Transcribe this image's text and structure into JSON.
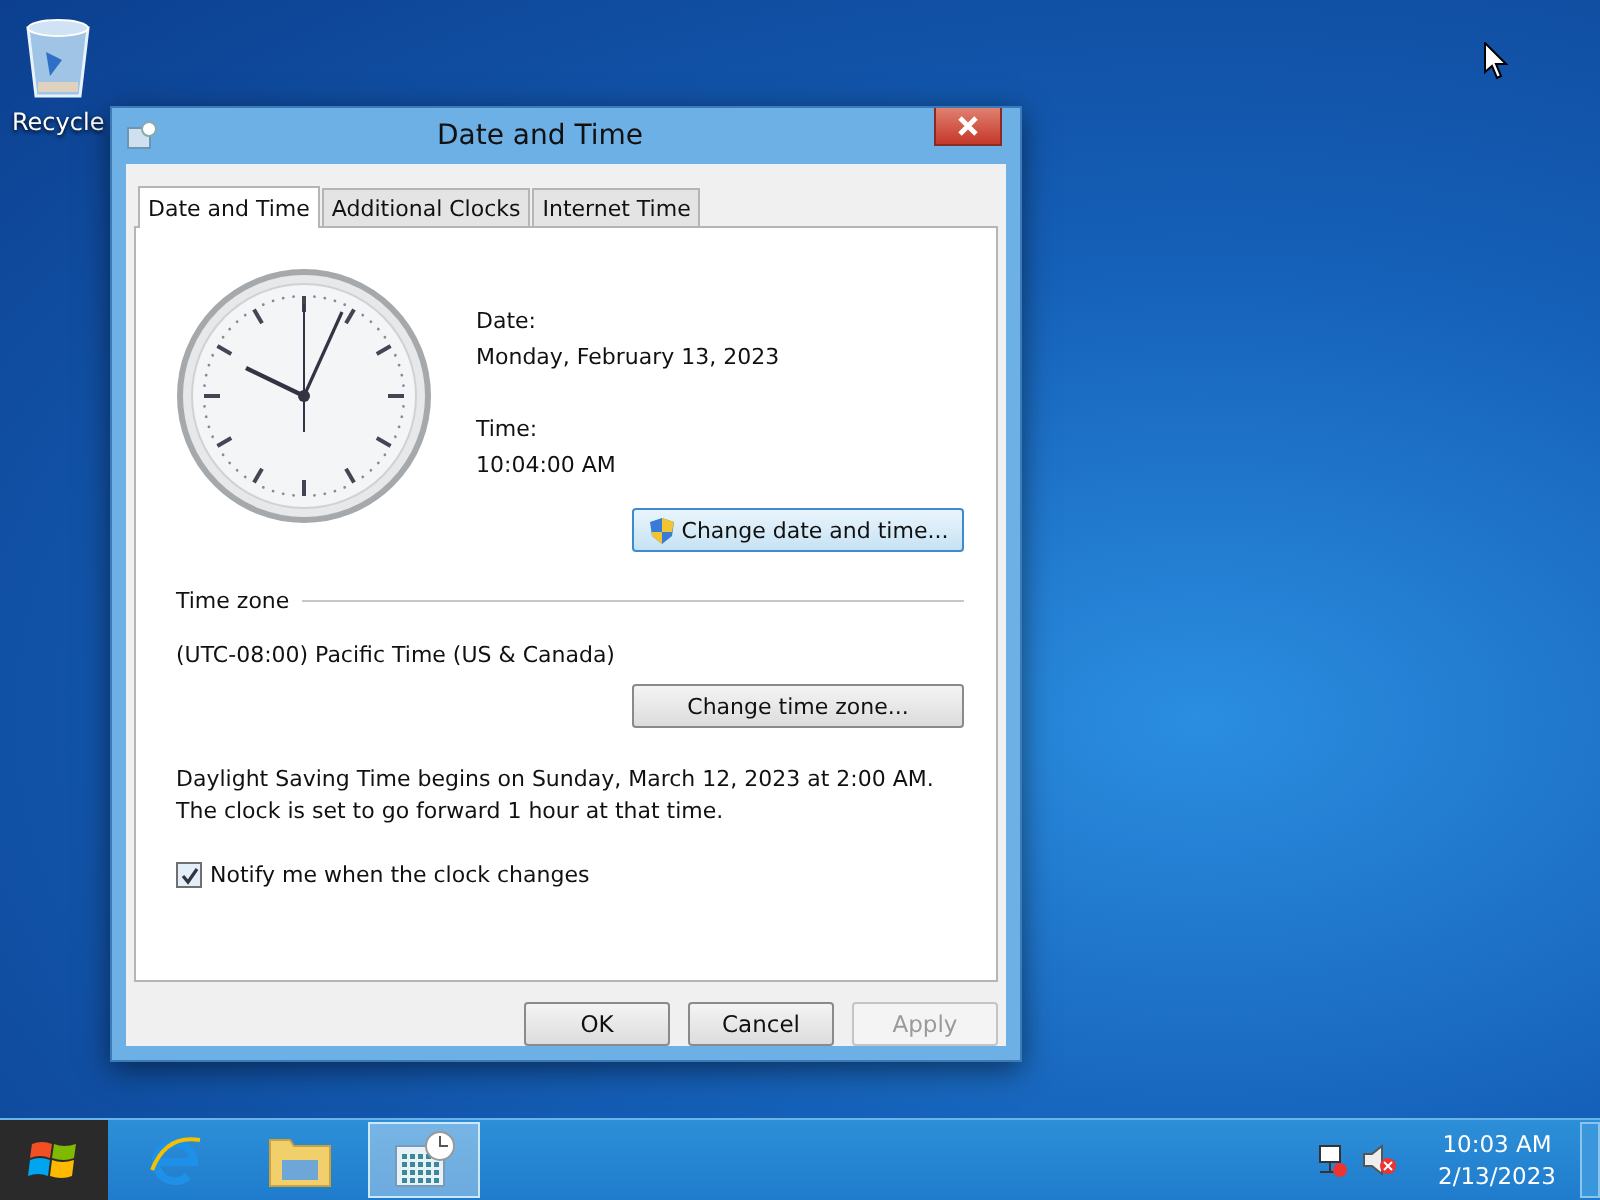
{
  "desktop": {
    "icons": [
      {
        "label": "Recycle"
      }
    ]
  },
  "window": {
    "title": "Date and Time"
  },
  "tabs": [
    {
      "label": "Date and Time",
      "selected": true
    },
    {
      "label": "Additional Clocks",
      "selected": false
    },
    {
      "label": "Internet Time",
      "selected": false
    }
  ],
  "date": {
    "label": "Date:",
    "value": "Monday, February 13, 2023"
  },
  "time": {
    "label": "Time:",
    "value": "10:04:00 AM"
  },
  "change_date_button": {
    "label": "Change date and time..."
  },
  "time_zone": {
    "heading": "Time zone",
    "value": "(UTC-08:00) Pacific Time (US & Canada)",
    "button": "Change time zone..."
  },
  "dst_note": "Daylight Saving Time begins on Sunday, March 12, 2023 at 2:00 AM. The clock is set to go forward 1 hour at that time.",
  "notify_checkbox": {
    "label": "Notify me when the clock changes",
    "checked": true
  },
  "buttons": [
    {
      "label": "OK",
      "disabled": false
    },
    {
      "label": "Cancel",
      "disabled": false
    },
    {
      "label": "Apply",
      "disabled": true
    }
  ],
  "taskbar": {
    "apps": [
      {
        "kind": "browser",
        "selected": false
      },
      {
        "kind": "folder",
        "selected": false
      },
      {
        "kind": "calendar",
        "selected": true
      }
    ],
    "clock": {
      "time": "10:03 AM",
      "date": "2/13/2023"
    }
  }
}
